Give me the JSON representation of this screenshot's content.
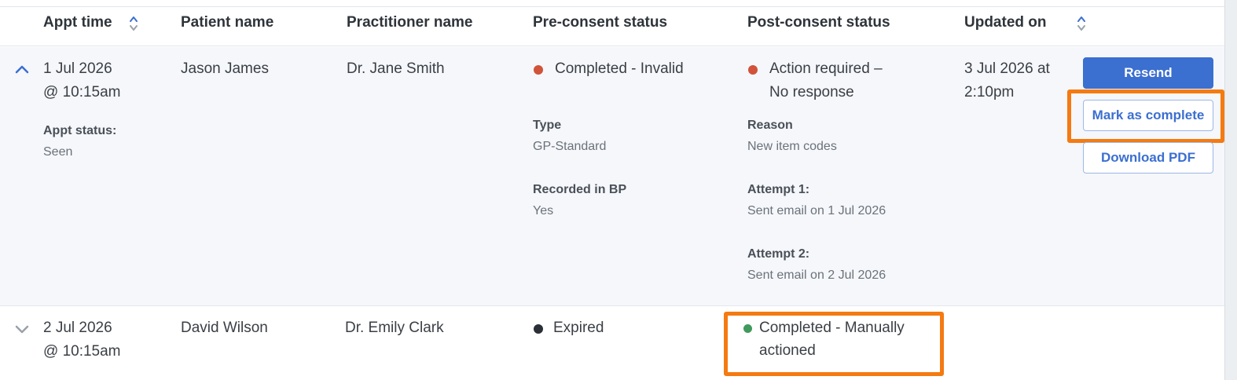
{
  "columns": {
    "appt_time": "Appt time",
    "patient_name": "Patient name",
    "practitioner_name": "Practitioner name",
    "pre_consent": "Pre-consent status",
    "post_consent": "Post-consent status",
    "updated_on": "Updated on"
  },
  "rows": [
    {
      "appt_date": "1 Jul 2026",
      "appt_time": "@ 10:15am",
      "appt_status_label": "Appt status:",
      "appt_status": "Seen",
      "patient": "Jason James",
      "practitioner": "Dr. Jane Smith",
      "pre_status": "Completed - Invalid",
      "pre_status_color": "#d0533a",
      "type_label": "Type",
      "type_value": "GP-Standard",
      "recorded_label": "Recorded in BP",
      "recorded_value": "Yes",
      "post_status_line1": "Action required –",
      "post_status_line2": "No response",
      "post_status_color": "#d0533a",
      "reason_label": "Reason",
      "reason_value": "New item codes",
      "attempt1_label": "Attempt 1:",
      "attempt1_value": "Sent email on 1 Jul 2026",
      "attempt2_label": "Attempt 2:",
      "attempt2_value": "Sent email on 2 Jul 2026",
      "updated_line1": "3 Jul 2026 at",
      "updated_line2": "2:10pm",
      "actions": {
        "resend": "Resend",
        "mark_complete": "Mark as complete",
        "download_pdf": "Download PDF"
      }
    },
    {
      "appt_date": "2 Jul 2026",
      "appt_time": "@ 10:15am",
      "patient": "David Wilson",
      "practitioner": "Dr. Emily Clark",
      "pre_status": "Expired",
      "pre_status_color": "#2b2f36",
      "post_status_line1": "Completed - Manually",
      "post_status_line2": "actioned",
      "post_status_color": "#3f9a5c"
    }
  ],
  "colors": {
    "accent": "#3b6fd0",
    "highlight": "#f47a11",
    "expanded_row_bg": "#f5f7fb"
  },
  "icons": [
    "sort-icon",
    "chevron-up-icon",
    "chevron-down-icon",
    "status-dot-icon"
  ]
}
